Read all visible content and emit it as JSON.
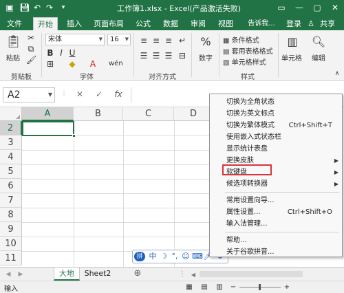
{
  "titlebar": {
    "title": "工作簿1.xlsx - Excel(产品激活失败)",
    "save_icon": "save-icon",
    "undo_icon": "undo-icon",
    "redo_icon": "redo-icon"
  },
  "tabs": [
    {
      "label": "文件"
    },
    {
      "label": "开始"
    },
    {
      "label": "插入"
    },
    {
      "label": "页面布局"
    },
    {
      "label": "公式"
    },
    {
      "label": "数据"
    },
    {
      "label": "审阅"
    },
    {
      "label": "视图"
    },
    {
      "label": "告诉我..."
    }
  ],
  "tabbar": {
    "login": "登录",
    "share": "共享"
  },
  "ribbon": {
    "paste_label": "粘贴",
    "font_name": "宋体",
    "font_size": "16",
    "number_label": "数字",
    "cond_format": "条件格式",
    "table_format": "套用表格格式",
    "cell_style": "单元格样式",
    "cells_label": "单元格",
    "edit_label": "编辑",
    "groups": {
      "clipboard": "剪贴板",
      "font": "字体",
      "alignment": "对齐方式",
      "styles": "样式"
    },
    "bold": "B",
    "italic": "I",
    "underline": "U",
    "font_color_letter": "A"
  },
  "formula_bar": {
    "name_box": "A2",
    "cancel": "✕",
    "enter": "✓",
    "fx": "fx"
  },
  "grid": {
    "columns": [
      "A",
      "B",
      "C",
      "D"
    ],
    "rows": [
      "2",
      "3",
      "4",
      "5",
      "6",
      "7",
      "8",
      "9",
      "10",
      "11"
    ],
    "selected_cell": "A2"
  },
  "sheets": {
    "tabs": [
      "大地",
      "Sheet2"
    ],
    "active": "大地",
    "add": "⊕"
  },
  "statusbar": {
    "mode": "输入"
  },
  "context_menu": {
    "items": [
      {
        "label": "切换为全角状态",
        "shortcut": "",
        "submenu": false
      },
      {
        "label": "切换为英文标点",
        "shortcut": "",
        "submenu": false
      },
      {
        "label": "切换为繁体模式",
        "shortcut": "Ctrl+Shift+T",
        "submenu": false
      },
      {
        "label": "使用嵌入式状态栏",
        "shortcut": "",
        "submenu": false
      },
      {
        "label": "显示统计表盘",
        "shortcut": "",
        "submenu": false
      },
      {
        "label": "更换皮肤",
        "shortcut": "",
        "submenu": true
      },
      {
        "label": "软键盘",
        "shortcut": "",
        "submenu": true
      },
      {
        "label": "候选项转换器",
        "shortcut": "",
        "submenu": true
      },
      {
        "label": "常用设置向导...",
        "shortcut": "",
        "submenu": false
      },
      {
        "label": "属性设置...",
        "shortcut": "Ctrl+Shift+O",
        "submenu": false
      },
      {
        "label": "输入法管理...",
        "shortcut": "",
        "submenu": false
      },
      {
        "label": "帮助...",
        "shortcut": "",
        "submenu": false
      },
      {
        "label": "关于谷歌拼音...",
        "shortcut": "",
        "submenu": false
      }
    ],
    "highlighted": "软键盘"
  },
  "ime_bar": {
    "mode_char": "中",
    "logo_char": "拼"
  },
  "colors": {
    "accent": "#217346",
    "highlight_box": "#d9343a"
  }
}
